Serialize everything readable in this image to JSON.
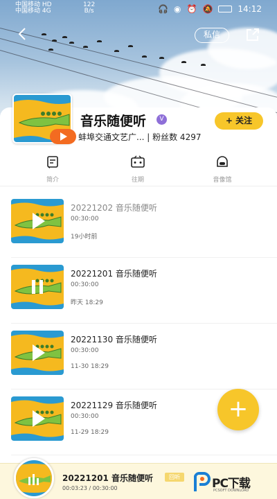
{
  "status_bar": {
    "carrier1": "中国移动",
    "carrier2": "中国移动",
    "net1": "HD",
    "net2": "4G",
    "speed": "122",
    "speed_unit": "B/s",
    "time": "14:12"
  },
  "header": {
    "message_label": "私信",
    "icons": [
      "back-arrow-icon",
      "share-icon"
    ]
  },
  "profile": {
    "title": "音乐随便听",
    "subline": "蚌埠交通文艺广... | 粉丝数 4297",
    "follow_label": "+ 关注",
    "accent_color": "#f7c62a"
  },
  "tabs": [
    {
      "label": "简介",
      "icon": "document-icon"
    },
    {
      "label": "往期",
      "icon": "radio-icon"
    },
    {
      "label": "音像馆",
      "icon": "robot-icon"
    }
  ],
  "episodes": [
    {
      "title": "20221202 音乐随便听",
      "duration": "00:30:00",
      "when": "19小时前",
      "state": "play",
      "played": true
    },
    {
      "title": "20221201 音乐随便听",
      "duration": "00:30:00",
      "when": "昨天 18:29",
      "state": "pause",
      "played": false
    },
    {
      "title": "20221130 音乐随便听",
      "duration": "00:30:00",
      "when": "11-30 18:29",
      "state": "play",
      "played": false
    },
    {
      "title": "20221129 音乐随便听",
      "duration": "00:30:00",
      "when": "11-29 18:29",
      "state": "play",
      "played": false
    }
  ],
  "player": {
    "title": "20221201 音乐随便听",
    "tag": "回听",
    "progress": "00:03:23 / 00:30:00",
    "watermark": "PC下载",
    "watermark_sub": "PCSOFT DOWNLOAD"
  }
}
